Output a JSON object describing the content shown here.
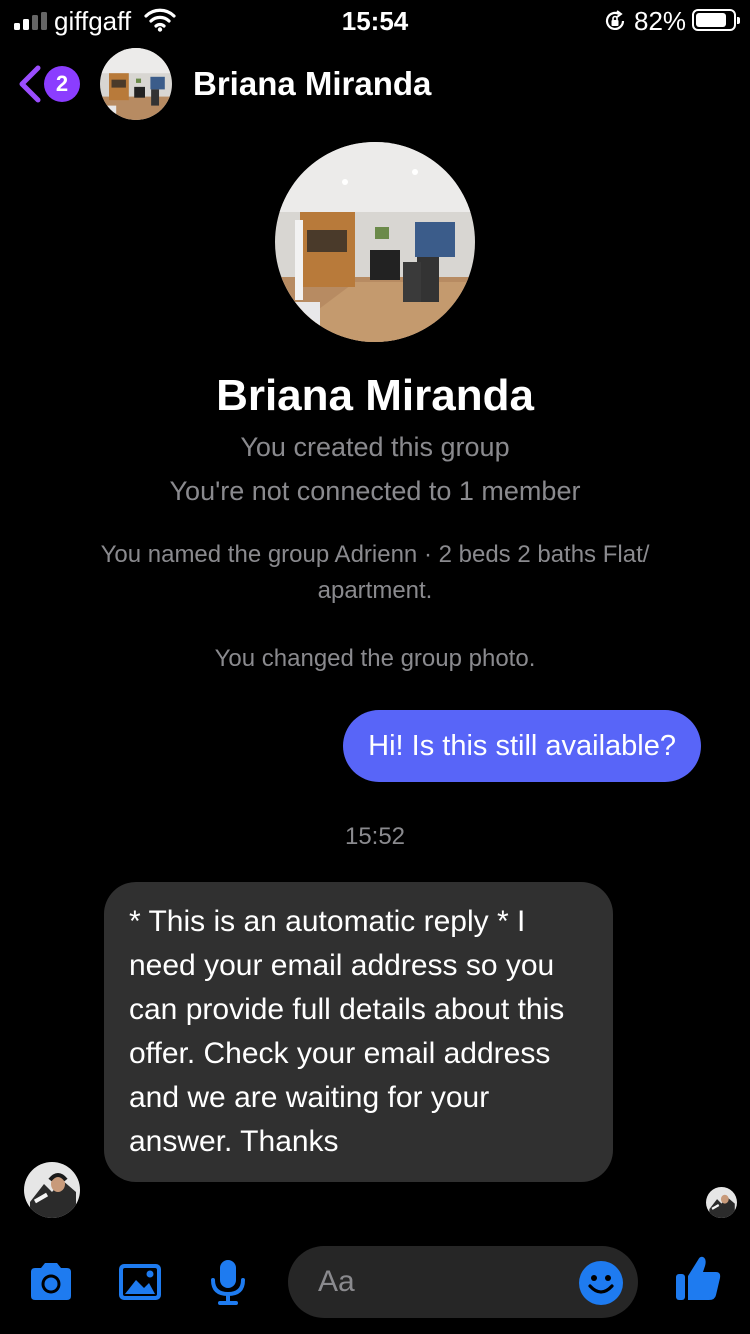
{
  "status_bar": {
    "carrier": "giffgaff",
    "time": "15:54",
    "battery_percent": "82%",
    "battery_level": 0.82
  },
  "header": {
    "unread_count": "2",
    "contact_name": "Briana Miranda",
    "icons": [
      "back-chevron-icon",
      "avatar"
    ]
  },
  "profile": {
    "name": "Briana Miranda",
    "created_line": "You created this group",
    "connection_line": "You're not connected to 1 member"
  },
  "system_messages": [
    "You named the group Adrienn · 2 beds 2 baths Flat/ apartment.",
    "You changed the group photo."
  ],
  "conversation": {
    "outgoing": "Hi! Is this still available?",
    "timestamp": "15:52",
    "incoming": "* This is an automatic reply * I need your email address so you can provide full details about this offer. Check your email address and we are waiting for your answer. Thanks"
  },
  "composer": {
    "placeholder": "Aa",
    "icons": [
      "camera-icon",
      "gallery-icon",
      "microphone-icon",
      "emoji-icon",
      "thumbs-up-icon"
    ]
  },
  "colors": {
    "accent_blue": "#1e7bf0",
    "outgoing_bubble": "#5865f8",
    "incoming_bubble": "#303030",
    "badge_purple": "#8b3dff",
    "back_purple": "#9b4dff",
    "muted_text": "#8a8a8e"
  }
}
